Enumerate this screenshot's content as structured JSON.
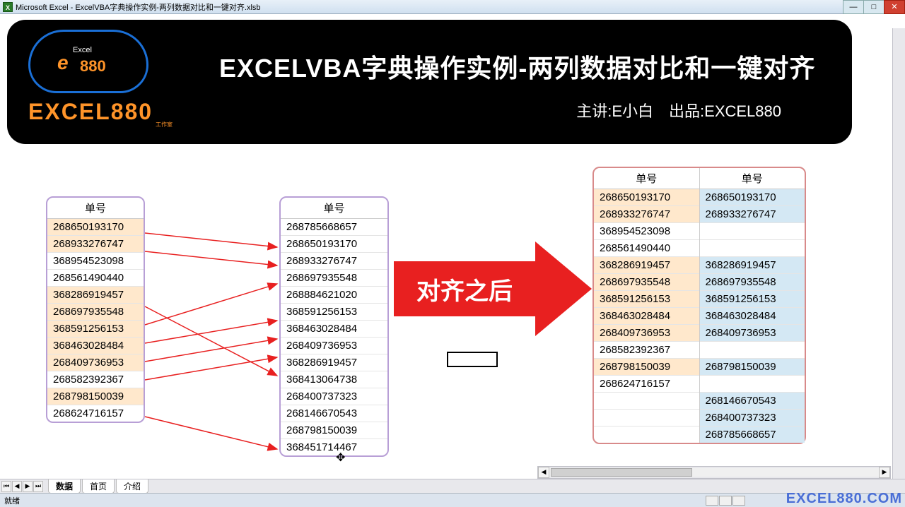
{
  "window": {
    "app": "Microsoft Excel",
    "file": "ExcelVBA字典操作实例-两列数据对比和一键对齐.xlsb",
    "title": "Microsoft Excel - ExcelVBA字典操作实例-两列数据对比和一键对齐.xlsb"
  },
  "banner": {
    "title": "EXCELVBA字典操作实例-两列数据对比和一键对齐",
    "subtitle": "主讲:E小白　出品:EXCEL880",
    "brand": "EXCEL880",
    "brand_sub": "工作室",
    "cloud_small": "Excel",
    "cloud_num": "880",
    "cloud_e": "e"
  },
  "arrow": {
    "label": "对齐之后"
  },
  "left_table": {
    "header": "单号",
    "rows": [
      {
        "v": "268650193170",
        "hl": true
      },
      {
        "v": "268933276747",
        "hl": true
      },
      {
        "v": "368954523098",
        "hl": false
      },
      {
        "v": "268561490440",
        "hl": false
      },
      {
        "v": "368286919457",
        "hl": true
      },
      {
        "v": "268697935548",
        "hl": true
      },
      {
        "v": "368591256153",
        "hl": true
      },
      {
        "v": "368463028484",
        "hl": true
      },
      {
        "v": "268409736953",
        "hl": true
      },
      {
        "v": "268582392367",
        "hl": false
      },
      {
        "v": "268798150039",
        "hl": true
      },
      {
        "v": "268624716157",
        "hl": false
      }
    ]
  },
  "mid_table": {
    "header": "单号",
    "rows": [
      "268785668657",
      "268650193170",
      "268933276747",
      "268697935548",
      "268884621020",
      "368591256153",
      "368463028484",
      "268409736953",
      "368286919457",
      "368413064738",
      "268400737323",
      "268146670543",
      "268798150039",
      "368451714467"
    ]
  },
  "right_table": {
    "header_a": "单号",
    "header_b": "单号",
    "rows": [
      {
        "a": "268650193170",
        "b": "268650193170",
        "hla": true,
        "hlb": true
      },
      {
        "a": "268933276747",
        "b": "268933276747",
        "hla": true,
        "hlb": true
      },
      {
        "a": "368954523098",
        "b": "",
        "hla": false,
        "hlb": false
      },
      {
        "a": "268561490440",
        "b": "",
        "hla": false,
        "hlb": false
      },
      {
        "a": "368286919457",
        "b": "368286919457",
        "hla": true,
        "hlb": true
      },
      {
        "a": "268697935548",
        "b": "268697935548",
        "hla": true,
        "hlb": true
      },
      {
        "a": "368591256153",
        "b": "368591256153",
        "hla": true,
        "hlb": true
      },
      {
        "a": "368463028484",
        "b": "368463028484",
        "hla": true,
        "hlb": true
      },
      {
        "a": "268409736953",
        "b": "268409736953",
        "hla": true,
        "hlb": true
      },
      {
        "a": "268582392367",
        "b": "",
        "hla": false,
        "hlb": false
      },
      {
        "a": "268798150039",
        "b": "268798150039",
        "hla": true,
        "hlb": true
      },
      {
        "a": "268624716157",
        "b": "",
        "hla": false,
        "hlb": false
      },
      {
        "a": "",
        "b": "268146670543",
        "hla": false,
        "hlb": true
      },
      {
        "a": "",
        "b": "268400737323",
        "hla": false,
        "hlb": true
      },
      {
        "a": "",
        "b": "268785668657",
        "hla": false,
        "hlb": true
      }
    ]
  },
  "sheets": {
    "tab1": "数据",
    "tab2": "首页",
    "tab3": "介绍"
  },
  "status": {
    "ready": "就绪"
  },
  "watermark": "EXCEL880.COM"
}
